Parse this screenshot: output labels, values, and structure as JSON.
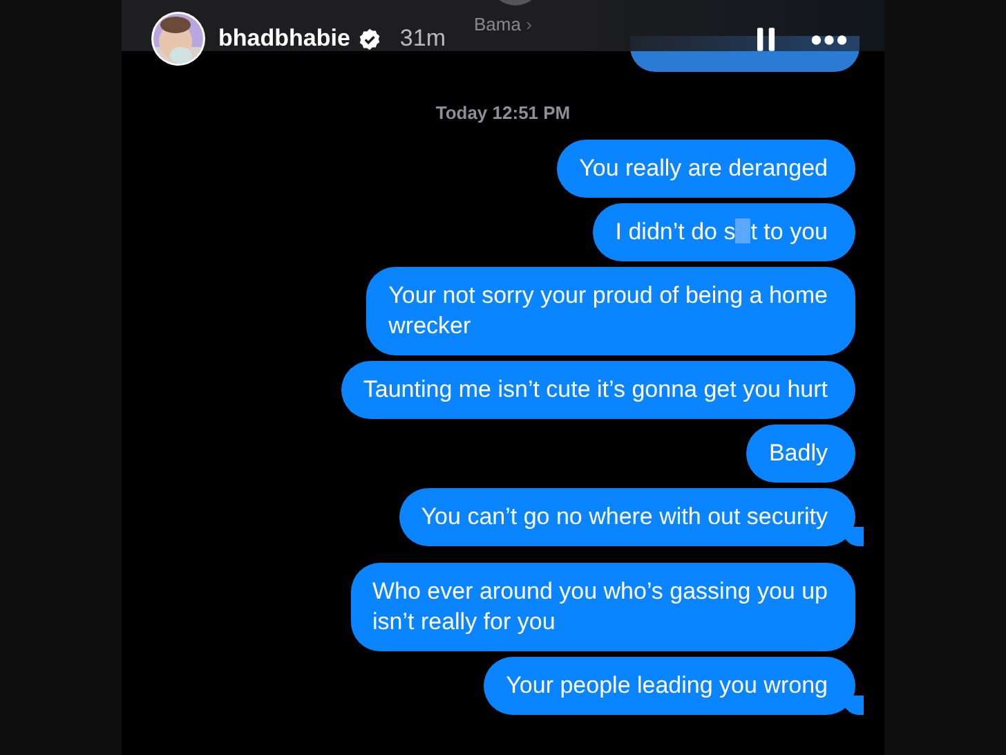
{
  "header": {
    "username": "bhadbhabie",
    "verified": true,
    "time": "31m",
    "song": "Bama",
    "song_chevron": "›"
  },
  "date": "Today 12:51 PM",
  "messages": [
    {
      "kind": "text",
      "text": "You really are deranged",
      "tail": false
    },
    {
      "kind": "censored",
      "parts": [
        "I didn’t do s",
        "t to you"
      ],
      "tail": false
    },
    {
      "kind": "text",
      "text": "Your not sorry your proud of being a home\nwrecker",
      "tail": false
    },
    {
      "kind": "text",
      "text": "Taunting me isn’t cute it’s gonna get you hurt",
      "tail": false
    },
    {
      "kind": "text",
      "text": "Badly",
      "tail": false
    },
    {
      "kind": "text",
      "text": "You can’t go no where with out security",
      "tail": true
    },
    {
      "kind": "text",
      "text": "Who ever around you who’s gassing you up\nisn’t really for you",
      "tail": false
    },
    {
      "kind": "text",
      "text": "Your people leading you wrong",
      "tail": true
    }
  ]
}
